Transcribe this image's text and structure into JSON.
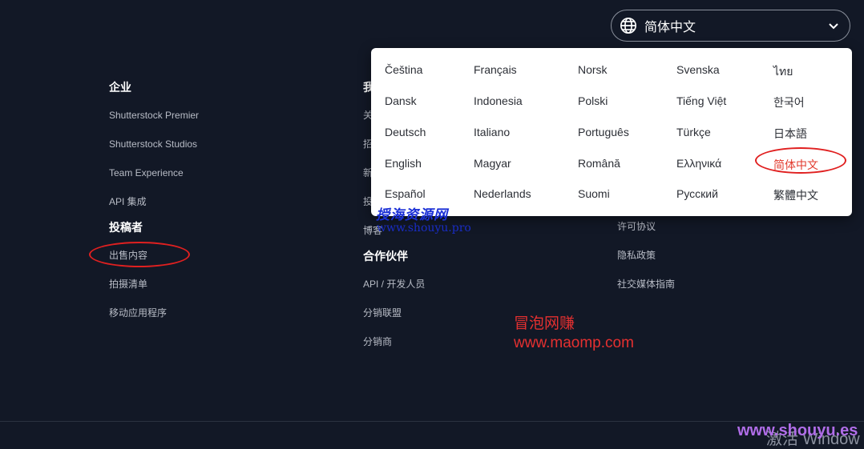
{
  "header": {
    "language_selector": {
      "icon": "globe-icon",
      "current": "简体中文",
      "chevron": "chevron-down-icon"
    }
  },
  "footer": {
    "enterprise": {
      "heading": "企业",
      "links": [
        "Shutterstock Premier",
        "Shutterstock Studios",
        "Team Experience",
        "API 集成"
      ]
    },
    "contributors": {
      "heading": "投稿者",
      "links": [
        "出售内容",
        "拍摄清单",
        "移动应用程序"
      ]
    },
    "about": {
      "heading_partial": "我",
      "links_partial": [
        "关",
        "招",
        "新",
        "投",
        "博客"
      ]
    },
    "partners": {
      "heading": "合作伙伴",
      "links": [
        "API / 开发人员",
        "分销联盟",
        "分销商"
      ]
    },
    "legal": {
      "links": [
        "许可协议",
        "隐私政策",
        "社交媒体指南"
      ]
    }
  },
  "language_dropdown": {
    "columns": [
      [
        "Čeština",
        "Dansk",
        "Deutsch",
        "English",
        "Español"
      ],
      [
        "Français",
        "Indonesia",
        "Italiano",
        "Magyar",
        "Nederlands"
      ],
      [
        "Norsk",
        "Polski",
        "Português",
        "Română",
        "Suomi"
      ],
      [
        "Svenska",
        "Tiếng Việt",
        "Türkçe",
        "Ελληνικά",
        "Русский"
      ],
      [
        "ไทย",
        "한국어",
        "日本語",
        "简体中文",
        "繁體中文"
      ]
    ],
    "selected": "简体中文"
  },
  "watermarks": {
    "top_cn": "授海资源网",
    "top_url": "www.shouyu.pro",
    "mid_cn": "冒泡网赚",
    "mid_url": "www.maomp.com",
    "corner_gray": "激活 Window",
    "corner_purple": "www.shouyu.es"
  },
  "colors": {
    "background": "#121826",
    "dropdown_bg": "#ffffff",
    "selected_lang": "#e23b2e",
    "annotation_ring": "#e02020"
  }
}
